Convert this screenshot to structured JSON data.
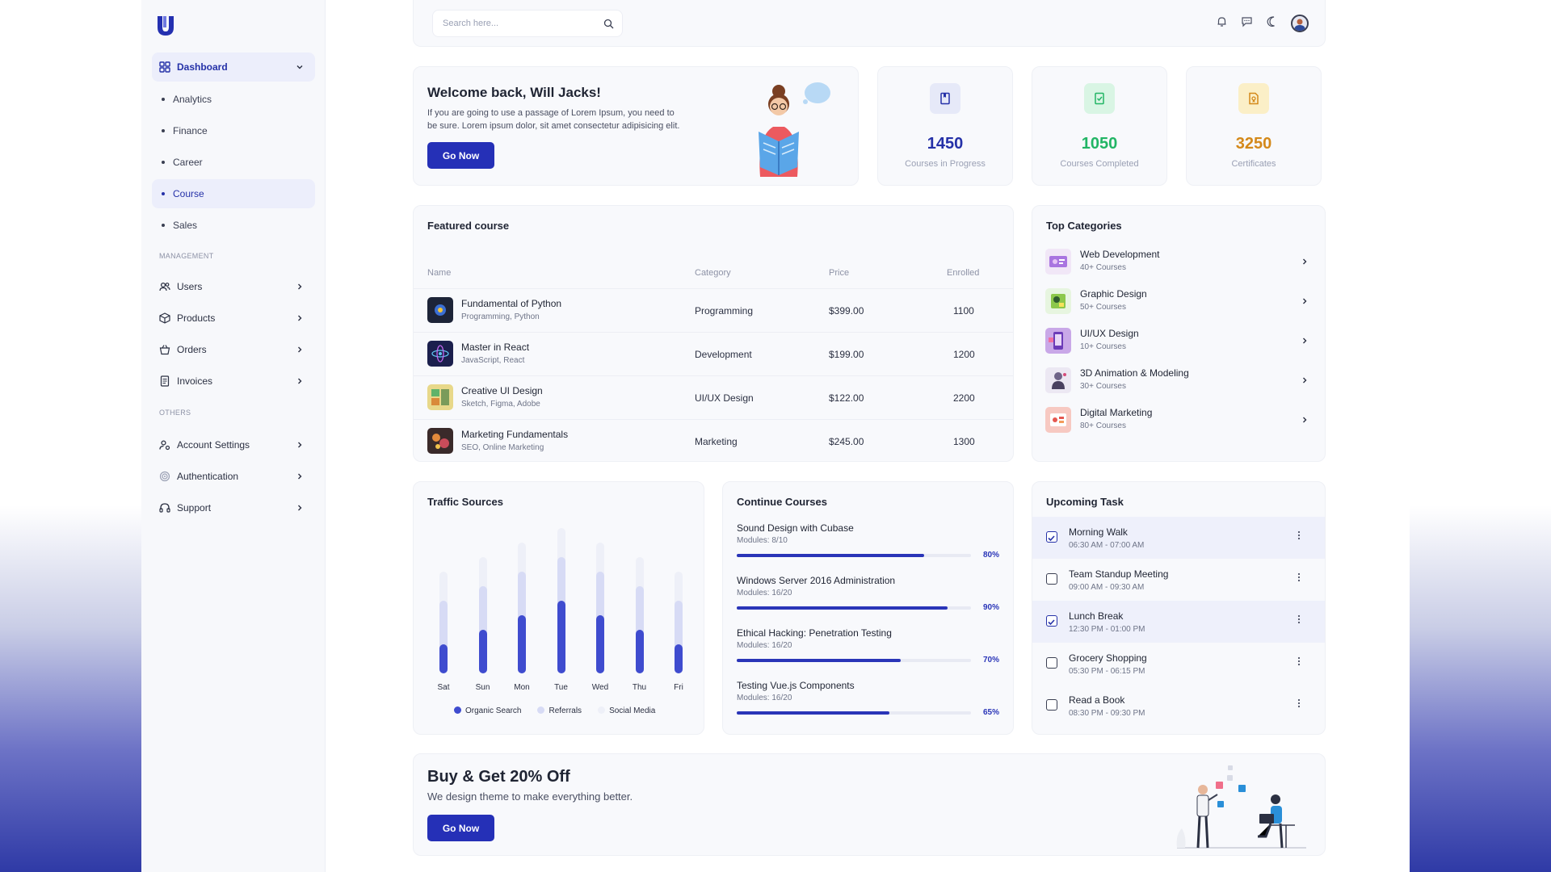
{
  "search": {
    "placeholder": "Search here..."
  },
  "sidebar": {
    "dashboard_label": "Dashboard",
    "sub_items": [
      "Analytics",
      "Finance",
      "Career",
      "Course",
      "Sales"
    ],
    "management_label": "MANAGEMENT",
    "management_items": [
      "Users",
      "Products",
      "Orders",
      "Invoices"
    ],
    "others_label": "OTHERS",
    "others_items": [
      "Account Settings",
      "Authentication",
      "Support"
    ]
  },
  "welcome": {
    "title": "Welcome back, Will Jacks!",
    "text_line1": "If you are going to use a passage of Lorem Ipsum, you need to",
    "text_line2": "be sure. Lorem ipsum dolor, sit amet consectetur adipisicing elit.",
    "button": "Go Now"
  },
  "stats": [
    {
      "value": "1450",
      "label": "Courses in Progress",
      "color": "#2531a8",
      "bg": "#e6e9f8"
    },
    {
      "value": "1050",
      "label": "Courses Completed",
      "color": "#22b565",
      "bg": "#d9f5e4"
    },
    {
      "value": "3250",
      "label": "Certificates",
      "color": "#d4891a",
      "bg": "#fbefc7"
    }
  ],
  "featured": {
    "title": "Featured course",
    "headers": {
      "name": "Name",
      "category": "Category",
      "price": "Price",
      "enrolled": "Enrolled"
    },
    "rows": [
      {
        "name": "Fundamental of Python",
        "tags": "Programming, Python",
        "category": "Programming",
        "price": "$399.00",
        "enrolled": "1100"
      },
      {
        "name": "Master in React",
        "tags": "JavaScript, React",
        "category": "Development",
        "price": "$199.00",
        "enrolled": "1200"
      },
      {
        "name": "Creative UI Design",
        "tags": "Sketch, Figma, Adobe",
        "category": "UI/UX Design",
        "price": "$122.00",
        "enrolled": "2200"
      },
      {
        "name": "Marketing Fundamentals",
        "tags": "SEO, Online Marketing",
        "category": "Marketing",
        "price": "$245.00",
        "enrolled": "1300"
      }
    ]
  },
  "categories": {
    "title": "Top Categories",
    "items": [
      {
        "name": "Web Development",
        "count": "40+ Courses"
      },
      {
        "name": "Graphic Design",
        "count": "50+ Courses"
      },
      {
        "name": "UI/UX Design",
        "count": "10+ Courses"
      },
      {
        "name": "3D Animation & Modeling",
        "count": "30+ Courses"
      },
      {
        "name": "Digital Marketing",
        "count": "80+ Courses"
      }
    ]
  },
  "traffic": {
    "title": "Traffic Sources",
    "legend": [
      "Organic Search",
      "Referrals",
      "Social Media"
    ]
  },
  "chart_data": {
    "type": "bar",
    "categories": [
      "Sat",
      "Sun",
      "Mon",
      "Tue",
      "Wed",
      "Thu",
      "Fri"
    ],
    "series": [
      {
        "name": "Organic Search",
        "values": [
          20,
          30,
          40,
          50,
          40,
          30,
          20
        ],
        "color": "#3f4ccf"
      },
      {
        "name": "Referrals",
        "values": [
          50,
          60,
          70,
          80,
          70,
          60,
          50
        ],
        "color": "#d7dbf5"
      },
      {
        "name": "Social Media",
        "values": [
          70,
          80,
          90,
          100,
          90,
          80,
          70
        ],
        "color": "#eef0f8"
      }
    ],
    "ylim": [
      0,
      100
    ],
    "grid": false,
    "legend_position": "bottom"
  },
  "continue": {
    "title": "Continue Courses",
    "items": [
      {
        "title": "Sound Design with Cubase",
        "modules": "Modules: 8/10",
        "percent": 80,
        "pct_label": "80%"
      },
      {
        "title": "Windows Server 2016 Administration",
        "modules": "Modules: 16/20",
        "percent": 90,
        "pct_label": "90%"
      },
      {
        "title": "Ethical Hacking: Penetration Testing",
        "modules": "Modules: 16/20",
        "percent": 70,
        "pct_label": "70%"
      },
      {
        "title": "Testing Vue.js Components",
        "modules": "Modules: 16/20",
        "percent": 65,
        "pct_label": "65%"
      }
    ]
  },
  "tasks": {
    "title": "Upcoming Task",
    "items": [
      {
        "name": "Morning Walk",
        "time": "06:30 AM - 07:00 AM",
        "checked": true
      },
      {
        "name": "Team Standup Meeting",
        "time": "09:00 AM - 09:30 AM",
        "checked": false
      },
      {
        "name": "Lunch Break",
        "time": "12:30 PM - 01:00 PM",
        "checked": true
      },
      {
        "name": "Grocery Shopping",
        "time": "05:30 PM - 06:15 PM",
        "checked": false
      },
      {
        "name": "Read a Book",
        "time": "08:30 PM - 09:30 PM",
        "checked": false
      }
    ]
  },
  "promo": {
    "title": "Buy & Get 20% Off",
    "text": "We design theme to make everything better.",
    "button": "Go Now"
  }
}
